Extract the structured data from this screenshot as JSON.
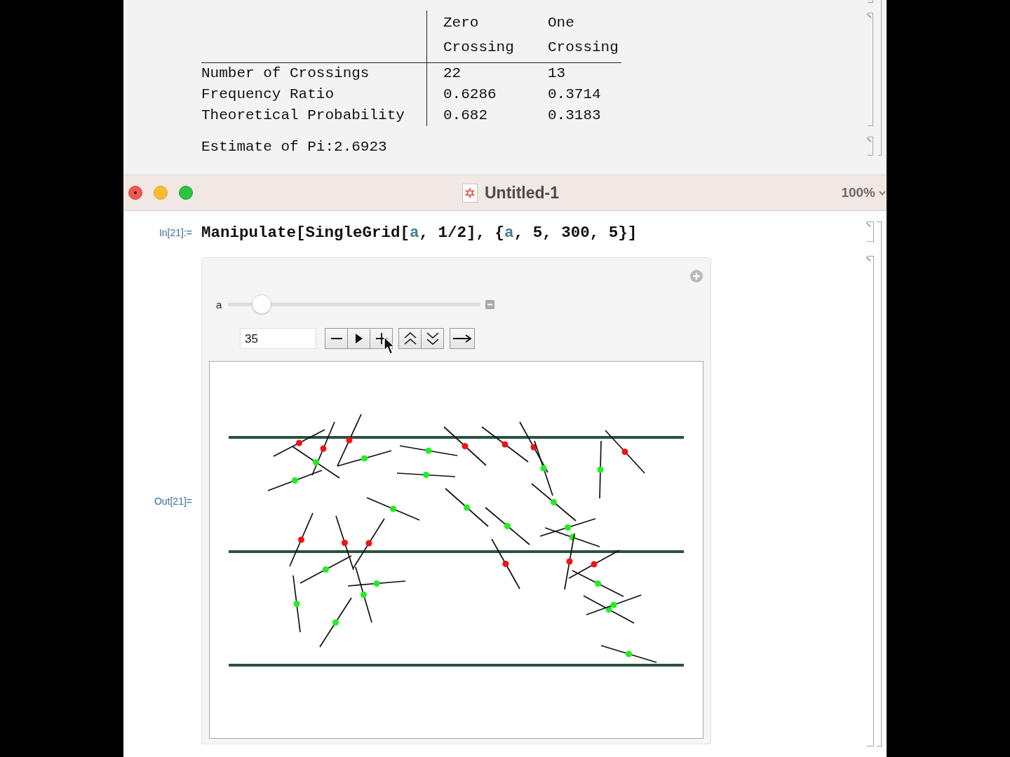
{
  "notebook_above": {
    "table": {
      "columns": [
        "Zero Crossing",
        "One Crossing"
      ],
      "rows": [
        {
          "label": "Number of Crossings",
          "values": [
            "22",
            "13"
          ]
        },
        {
          "label": "Frequency Ratio",
          "values": [
            "0.6286",
            "0.3714"
          ]
        },
        {
          "label": "Theoretical Probability",
          "values": [
            "0.682",
            "0.3183"
          ]
        }
      ]
    },
    "estimate": "Estimate of Pi:2.6923"
  },
  "window": {
    "title": "Untitled-1",
    "zoom": "100%"
  },
  "input_cell": {
    "label": "In[21]:=",
    "code": [
      {
        "text": "Manipulate[SingleGrid[",
        "kind": "plain"
      },
      {
        "text": "a",
        "kind": "variable"
      },
      {
        "text": ", 1/2], {",
        "kind": "plain"
      },
      {
        "text": "a",
        "kind": "variable"
      },
      {
        "text": ", 5, 300, 5}]",
        "kind": "plain"
      }
    ]
  },
  "output_cell": {
    "label": "Out[21]=",
    "manipulate": {
      "variable": "a",
      "level": 0.102,
      "value": "35",
      "button_groups": [
        [
          {
            "kind": "decrement"
          },
          {
            "kind": "play"
          },
          {
            "kind": "increment"
          }
        ],
        [
          {
            "kind": "faster"
          },
          {
            "kind": "slower"
          }
        ],
        [
          {
            "kind": "direction"
          }
        ]
      ]
    }
  }
}
